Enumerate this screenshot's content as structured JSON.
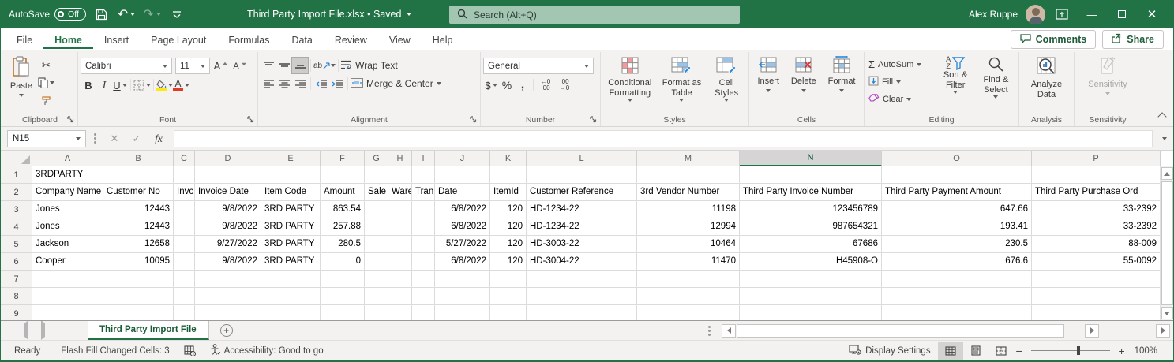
{
  "colors": {
    "excel_green": "#217346",
    "dark_green": "#185c37",
    "search_pill": "#a3c6b2",
    "highlight_yellow": "#ffe812",
    "font_color_red": "#e03b24",
    "accent_blue": "#2b579a"
  },
  "title_bar": {
    "autosave_label": "AutoSave",
    "autosave_state": "Off",
    "document_title": "Third Party Import File.xlsx • Saved",
    "search_placeholder": "Search (Alt+Q)",
    "user_name": "Alex Ruppe"
  },
  "ribbon_tabs": {
    "items": [
      "File",
      "Home",
      "Insert",
      "Page Layout",
      "Formulas",
      "Data",
      "Review",
      "View",
      "Help"
    ],
    "active": "Home",
    "comments_label": "Comments",
    "share_label": "Share"
  },
  "ribbon": {
    "clipboard": {
      "group_label": "Clipboard",
      "paste_label": "Paste"
    },
    "font": {
      "group_label": "Font",
      "font_name": "Calibri",
      "font_size": "11",
      "bold_glyph": "B",
      "italic_glyph": "I",
      "underline_glyph": "U",
      "grow_glyph": "A",
      "shrink_glyph": "A",
      "font_color_glyph": "A"
    },
    "alignment": {
      "group_label": "Alignment",
      "wrap_text_label": "Wrap Text",
      "merge_center_label": "Merge & Center",
      "orientation_glyph": "ab"
    },
    "number": {
      "group_label": "Number",
      "format_value": "General",
      "currency_glyph": "$",
      "percent_glyph": "%",
      "comma_glyph": ",",
      "inc_dec_top": "←0",
      "inc_dec_bottom": ".00",
      "dec_dec_top": ".00",
      "dec_dec_bottom": "→0"
    },
    "styles": {
      "group_label": "Styles",
      "conditional_label": "Conditional Formatting",
      "format_table_label": "Format as Table",
      "cell_styles_label": "Cell Styles"
    },
    "cells": {
      "group_label": "Cells",
      "insert_label": "Insert",
      "delete_label": "Delete",
      "format_label": "Format"
    },
    "editing": {
      "group_label": "Editing",
      "autosum_label": "AutoSum",
      "autosum_glyph": "Σ",
      "fill_label": "Fill",
      "clear_label": "Clear",
      "sort_filter_label": "Sort & Filter",
      "find_select_label": "Find & Select",
      "sort_a": "A",
      "sort_z": "Z"
    },
    "analysis": {
      "group_label": "Analysis",
      "analyze_label": "Analyze Data"
    },
    "sensitivity": {
      "group_label": "Sensitivity",
      "button_label": "Sensitivity"
    }
  },
  "formula_bar": {
    "name_box_value": "N15",
    "fx_glyph": "fx",
    "formula_value": ""
  },
  "grid": {
    "selected_column": "N",
    "columns": [
      {
        "letter": "A",
        "width": 90
      },
      {
        "letter": "B",
        "width": 89
      },
      {
        "letter": "C",
        "width": 27
      },
      {
        "letter": "D",
        "width": 84
      },
      {
        "letter": "E",
        "width": 75
      },
      {
        "letter": "F",
        "width": 56
      },
      {
        "letter": "G",
        "width": 30
      },
      {
        "letter": "H",
        "width": 30
      },
      {
        "letter": "I",
        "width": 29
      },
      {
        "letter": "J",
        "width": 70
      },
      {
        "letter": "K",
        "width": 46
      },
      {
        "letter": "L",
        "width": 140
      },
      {
        "letter": "M",
        "width": 130
      },
      {
        "letter": "N",
        "width": 180
      },
      {
        "letter": "O",
        "width": 190
      },
      {
        "letter": "P",
        "width": 163
      }
    ],
    "rows": [
      {
        "num": "1",
        "cells": [
          {
            "col": "A",
            "text": "3RDPARTY",
            "align": "left"
          }
        ]
      },
      {
        "num": "2",
        "cells": [
          {
            "col": "A",
            "text": "Company Name",
            "align": "left"
          },
          {
            "col": "B",
            "text": "Customer No",
            "align": "left"
          },
          {
            "col": "C",
            "text": "Invc",
            "align": "left"
          },
          {
            "col": "D",
            "text": "Invoice Date",
            "align": "left"
          },
          {
            "col": "E",
            "text": "Item Code",
            "align": "left"
          },
          {
            "col": "F",
            "text": "Amount",
            "align": "left"
          },
          {
            "col": "G",
            "text": "Sale",
            "align": "left"
          },
          {
            "col": "H",
            "text": "Ware",
            "align": "left"
          },
          {
            "col": "I",
            "text": "Tran",
            "align": "left"
          },
          {
            "col": "J",
            "text": "Date",
            "align": "left"
          },
          {
            "col": "K",
            "text": "ItemId",
            "align": "left"
          },
          {
            "col": "L",
            "text": "Customer Reference",
            "align": "left"
          },
          {
            "col": "M",
            "text": "3rd Vendor Number",
            "align": "left"
          },
          {
            "col": "N",
            "text": "Third Party Invoice Number",
            "align": "left"
          },
          {
            "col": "O",
            "text": "Third Party Payment Amount",
            "align": "left"
          },
          {
            "col": "P",
            "text": "Third Party Purchase Ord",
            "align": "left"
          }
        ]
      },
      {
        "num": "3",
        "cells": [
          {
            "col": "A",
            "text": "Jones",
            "align": "left"
          },
          {
            "col": "B",
            "text": "12443",
            "align": "right"
          },
          {
            "col": "D",
            "text": "9/8/2022",
            "align": "right"
          },
          {
            "col": "E",
            "text": "3RD PARTY",
            "align": "left"
          },
          {
            "col": "F",
            "text": "863.54",
            "align": "right"
          },
          {
            "col": "J",
            "text": "6/8/2022",
            "align": "right"
          },
          {
            "col": "K",
            "text": "120",
            "align": "right"
          },
          {
            "col": "L",
            "text": "HD-1234-22",
            "align": "left"
          },
          {
            "col": "M",
            "text": "11198",
            "align": "right"
          },
          {
            "col": "N",
            "text": "123456789",
            "align": "right"
          },
          {
            "col": "O",
            "text": "647.66",
            "align": "right"
          },
          {
            "col": "P",
            "text": "33-2392",
            "align": "right"
          }
        ]
      },
      {
        "num": "4",
        "cells": [
          {
            "col": "A",
            "text": "Jones",
            "align": "left"
          },
          {
            "col": "B",
            "text": "12443",
            "align": "right"
          },
          {
            "col": "D",
            "text": "9/8/2022",
            "align": "right"
          },
          {
            "col": "E",
            "text": "3RD PARTY",
            "align": "left"
          },
          {
            "col": "F",
            "text": "257.88",
            "align": "right"
          },
          {
            "col": "J",
            "text": "6/8/2022",
            "align": "right"
          },
          {
            "col": "K",
            "text": "120",
            "align": "right"
          },
          {
            "col": "L",
            "text": "HD-1234-22",
            "align": "left"
          },
          {
            "col": "M",
            "text": "12994",
            "align": "right"
          },
          {
            "col": "N",
            "text": "987654321",
            "align": "right"
          },
          {
            "col": "O",
            "text": "193.41",
            "align": "right"
          },
          {
            "col": "P",
            "text": "33-2392",
            "align": "right"
          }
        ]
      },
      {
        "num": "5",
        "cells": [
          {
            "col": "A",
            "text": "Jackson",
            "align": "left"
          },
          {
            "col": "B",
            "text": "12658",
            "align": "right"
          },
          {
            "col": "D",
            "text": "9/27/2022",
            "align": "right"
          },
          {
            "col": "E",
            "text": "3RD PARTY",
            "align": "left"
          },
          {
            "col": "F",
            "text": "280.5",
            "align": "right"
          },
          {
            "col": "J",
            "text": "5/27/2022",
            "align": "right"
          },
          {
            "col": "K",
            "text": "120",
            "align": "right"
          },
          {
            "col": "L",
            "text": "HD-3003-22",
            "align": "left"
          },
          {
            "col": "M",
            "text": "10464",
            "align": "right"
          },
          {
            "col": "N",
            "text": "67686",
            "align": "right"
          },
          {
            "col": "O",
            "text": "230.5",
            "align": "right"
          },
          {
            "col": "P",
            "text": "88-009",
            "align": "right"
          }
        ]
      },
      {
        "num": "6",
        "cells": [
          {
            "col": "A",
            "text": "Cooper",
            "align": "left"
          },
          {
            "col": "B",
            "text": "10095",
            "align": "right"
          },
          {
            "col": "D",
            "text": "9/8/2022",
            "align": "right"
          },
          {
            "col": "E",
            "text": "3RD PARTY",
            "align": "left"
          },
          {
            "col": "F",
            "text": "0",
            "align": "right"
          },
          {
            "col": "J",
            "text": "6/8/2022",
            "align": "right"
          },
          {
            "col": "K",
            "text": "120",
            "align": "right"
          },
          {
            "col": "L",
            "text": "HD-3004-22",
            "align": "left"
          },
          {
            "col": "M",
            "text": "11470",
            "align": "right"
          },
          {
            "col": "N",
            "text": "H45908-O",
            "align": "right"
          },
          {
            "col": "O",
            "text": "676.6",
            "align": "right"
          },
          {
            "col": "P",
            "text": "55-0092",
            "align": "right"
          }
        ]
      },
      {
        "num": "7",
        "cells": []
      },
      {
        "num": "8",
        "cells": []
      },
      {
        "num": "9",
        "cells": []
      }
    ]
  },
  "sheet_bar": {
    "active_tab": "Third Party Import File"
  },
  "status_bar": {
    "ready_label": "Ready",
    "flash_fill_text": "Flash Fill Changed Cells: 3",
    "accessibility_text": "Accessibility: Good to go",
    "display_settings_label": "Display Settings",
    "zoom_value": "100%"
  }
}
